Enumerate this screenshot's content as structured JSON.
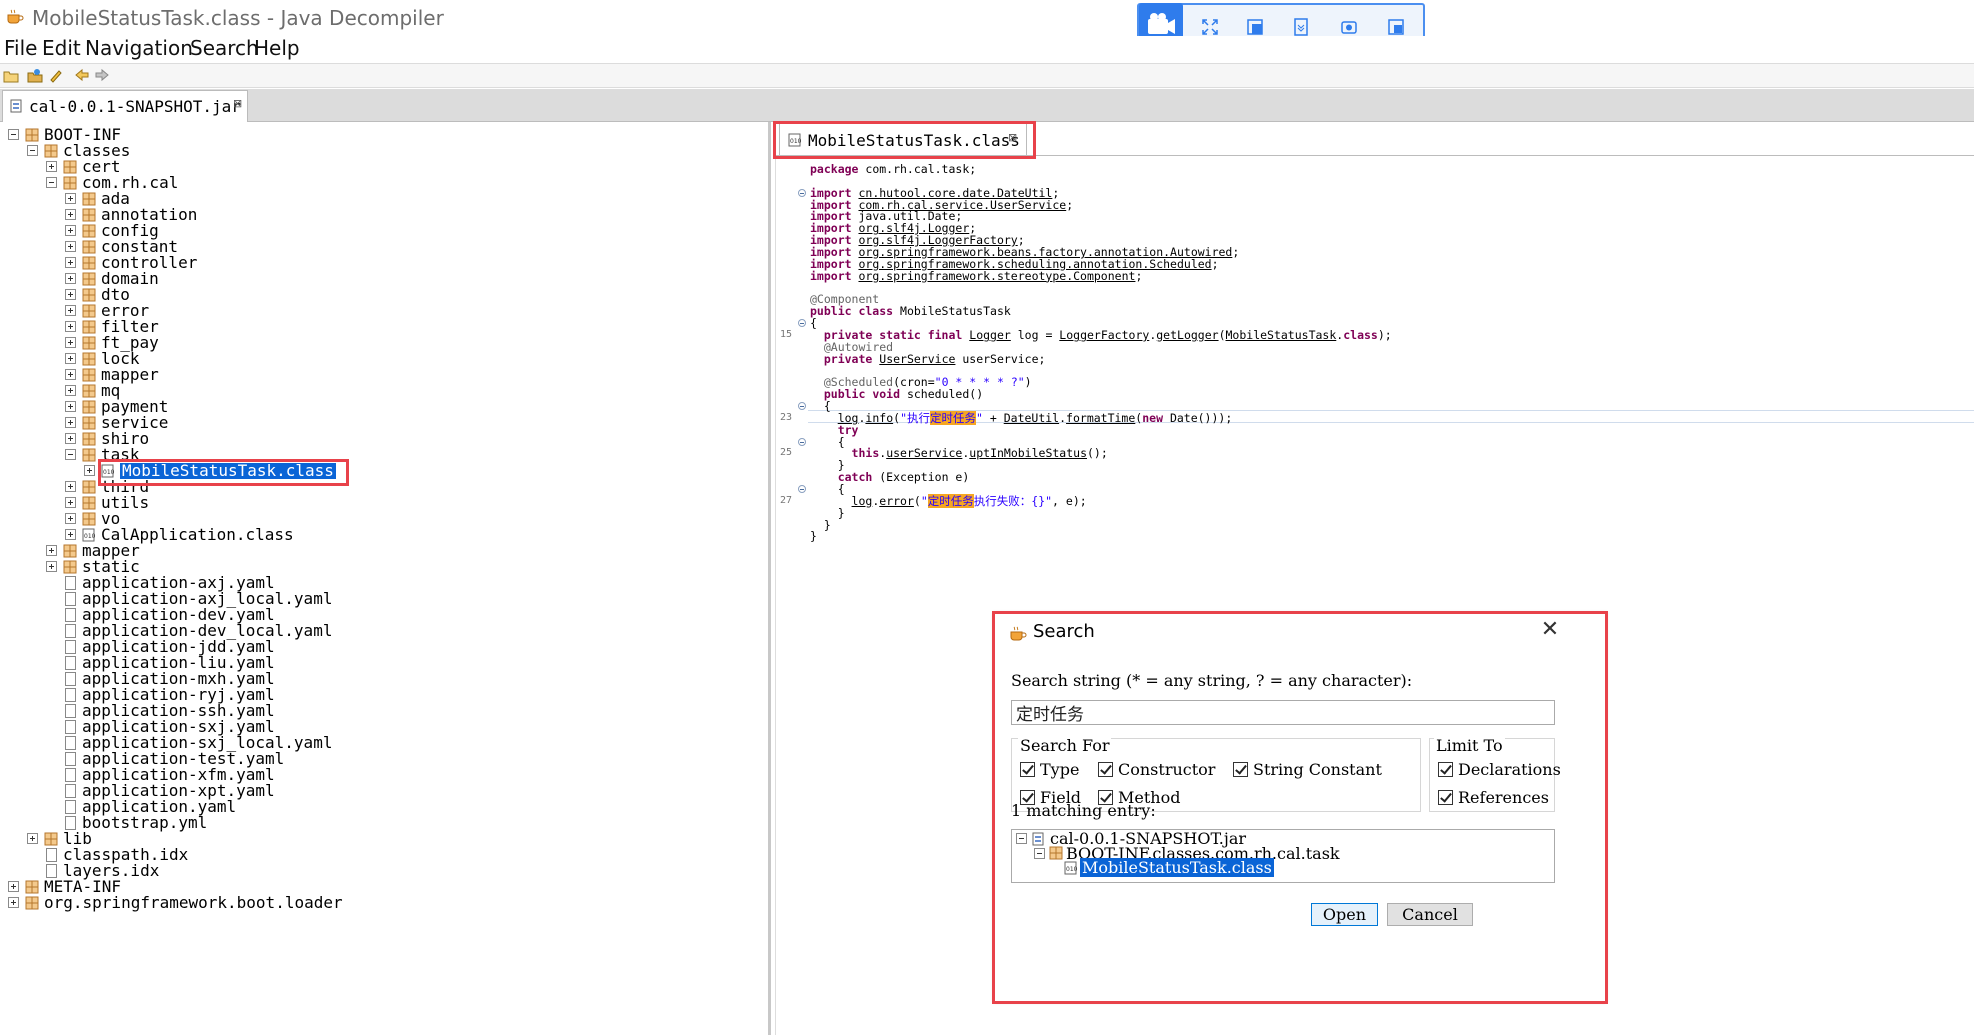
{
  "window": {
    "title": "MobileStatusTask.class - Java Decompiler"
  },
  "menu": [
    "File",
    "Edit",
    "Navigation",
    "Search",
    "Help"
  ],
  "toolbar_icons": [
    "open-file-icon",
    "open-type-icon",
    "search-icon",
    "back-icon",
    "forward-icon"
  ],
  "float_toolbar_icons": [
    "camera-icon",
    "fullscreen-icon",
    "region-icon",
    "scroll-capture-icon",
    "screenshot-icon",
    "window-capture-icon"
  ],
  "jar_tab": {
    "label": "cal-0.0.1-SNAPSHOT.jar"
  },
  "tree": [
    {
      "label": "BOOT-INF",
      "depth": 0,
      "type": "package",
      "expander": "minus"
    },
    {
      "label": "classes",
      "depth": 1,
      "type": "package",
      "expander": "minus"
    },
    {
      "label": "cert",
      "depth": 2,
      "type": "package",
      "expander": "plus"
    },
    {
      "label": "com.rh.cal",
      "depth": 2,
      "type": "package",
      "expander": "minus"
    },
    {
      "label": "ada",
      "depth": 3,
      "type": "package",
      "expander": "plus"
    },
    {
      "label": "annotation",
      "depth": 3,
      "type": "package",
      "expander": "plus"
    },
    {
      "label": "config",
      "depth": 3,
      "type": "package",
      "expander": "plus"
    },
    {
      "label": "constant",
      "depth": 3,
      "type": "package",
      "expander": "plus"
    },
    {
      "label": "controller",
      "depth": 3,
      "type": "package",
      "expander": "plus"
    },
    {
      "label": "domain",
      "depth": 3,
      "type": "package",
      "expander": "plus"
    },
    {
      "label": "dto",
      "depth": 3,
      "type": "package",
      "expander": "plus"
    },
    {
      "label": "error",
      "depth": 3,
      "type": "package",
      "expander": "plus"
    },
    {
      "label": "filter",
      "depth": 3,
      "type": "package",
      "expander": "plus"
    },
    {
      "label": "ft_pay",
      "depth": 3,
      "type": "package",
      "expander": "plus"
    },
    {
      "label": "lock",
      "depth": 3,
      "type": "package",
      "expander": "plus"
    },
    {
      "label": "mapper",
      "depth": 3,
      "type": "package",
      "expander": "plus"
    },
    {
      "label": "mq",
      "depth": 3,
      "type": "package",
      "expander": "plus"
    },
    {
      "label": "payment",
      "depth": 3,
      "type": "package",
      "expander": "plus"
    },
    {
      "label": "service",
      "depth": 3,
      "type": "package",
      "expander": "plus"
    },
    {
      "label": "shiro",
      "depth": 3,
      "type": "package",
      "expander": "plus"
    },
    {
      "label": "task",
      "depth": 3,
      "type": "package",
      "expander": "minus"
    },
    {
      "label": "MobileStatusTask.class",
      "depth": 4,
      "type": "class",
      "expander": "plus",
      "selected": true
    },
    {
      "label": "third",
      "depth": 3,
      "type": "package",
      "expander": "plus"
    },
    {
      "label": "utils",
      "depth": 3,
      "type": "package",
      "expander": "plus"
    },
    {
      "label": "vo",
      "depth": 3,
      "type": "package",
      "expander": "plus"
    },
    {
      "label": "CalApplication.class",
      "depth": 3,
      "type": "class",
      "expander": "plus"
    },
    {
      "label": "mapper",
      "depth": 2,
      "type": "package",
      "expander": "plus"
    },
    {
      "label": "static",
      "depth": 2,
      "type": "package",
      "expander": "plus"
    },
    {
      "label": "application-axj.yaml",
      "depth": 2,
      "type": "file"
    },
    {
      "label": "application-axj_local.yaml",
      "depth": 2,
      "type": "file"
    },
    {
      "label": "application-dev.yaml",
      "depth": 2,
      "type": "file"
    },
    {
      "label": "application-dev_local.yaml",
      "depth": 2,
      "type": "file"
    },
    {
      "label": "application-jdd.yaml",
      "depth": 2,
      "type": "file"
    },
    {
      "label": "application-liu.yaml",
      "depth": 2,
      "type": "file"
    },
    {
      "label": "application-mxh.yaml",
      "depth": 2,
      "type": "file"
    },
    {
      "label": "application-ryj.yaml",
      "depth": 2,
      "type": "file"
    },
    {
      "label": "application-ssh.yaml",
      "depth": 2,
      "type": "file"
    },
    {
      "label": "application-sxj.yaml",
      "depth": 2,
      "type": "file"
    },
    {
      "label": "application-sxj_local.yaml",
      "depth": 2,
      "type": "file"
    },
    {
      "label": "application-test.yaml",
      "depth": 2,
      "type": "file"
    },
    {
      "label": "application-xfm.yaml",
      "depth": 2,
      "type": "file"
    },
    {
      "label": "application-xpt.yaml",
      "depth": 2,
      "type": "file"
    },
    {
      "label": "application.yaml",
      "depth": 2,
      "type": "file"
    },
    {
      "label": "bootstrap.yml",
      "depth": 2,
      "type": "file"
    },
    {
      "label": "lib",
      "depth": 1,
      "type": "package",
      "expander": "plus"
    },
    {
      "label": "classpath.idx",
      "depth": 1,
      "type": "file"
    },
    {
      "label": "layers.idx",
      "depth": 1,
      "type": "file"
    },
    {
      "label": "META-INF",
      "depth": 0,
      "type": "package",
      "expander": "plus"
    },
    {
      "label": "org.springframework.boot.loader",
      "depth": 0,
      "type": "package",
      "expander": "plus"
    }
  ],
  "code_tab": {
    "label": "MobileStatusTask.class"
  },
  "code_lines": [
    {
      "ln": "",
      "fold": false,
      "html": "<span class=\"kw\">package</span> com.rh.cal.task;"
    },
    {
      "ln": "",
      "fold": false,
      "html": ""
    },
    {
      "ln": "",
      "fold": true,
      "html": "<span class=\"kw\">import</span> <span class=\"u\">cn.hutool.core.date.DateUtil</span>;"
    },
    {
      "ln": "",
      "fold": false,
      "html": "<span class=\"kw\">import</span> <span class=\"u\">com.rh.cal.service.UserService</span>;"
    },
    {
      "ln": "",
      "fold": false,
      "html": "<span class=\"kw\">import</span> java.util.Date;"
    },
    {
      "ln": "",
      "fold": false,
      "html": "<span class=\"kw\">import</span> <span class=\"u\">org.slf4j.Logger</span>;"
    },
    {
      "ln": "",
      "fold": false,
      "html": "<span class=\"kw\">import</span> <span class=\"u\">org.slf4j.LoggerFactory</span>;"
    },
    {
      "ln": "",
      "fold": false,
      "html": "<span class=\"kw\">import</span> <span class=\"u\">org.springframework.beans.factory.annotation.Autowired</span>;"
    },
    {
      "ln": "",
      "fold": false,
      "html": "<span class=\"kw\">import</span> <span class=\"u\">org.springframework.scheduling.annotation.Scheduled</span>;"
    },
    {
      "ln": "",
      "fold": false,
      "html": "<span class=\"kw\">import</span> <span class=\"u\">org.springframework.stereotype.Component</span>;"
    },
    {
      "ln": "",
      "fold": false,
      "html": ""
    },
    {
      "ln": "",
      "fold": false,
      "html": "<span class=\"ann\">@Component</span>"
    },
    {
      "ln": "",
      "fold": false,
      "html": "<span class=\"kw\">public class</span> MobileStatusTask"
    },
    {
      "ln": "",
      "fold": true,
      "html": "{"
    },
    {
      "ln": "15",
      "fold": false,
      "html": "  <span class=\"kw\">private static final</span> <span class=\"u\">Logger</span> log = <span class=\"u\">LoggerFactory</span>.<span class=\"u\">getLogger</span>(<span class=\"u\">MobileStatusTask</span>.<span class=\"kw\">class</span>);"
    },
    {
      "ln": "",
      "fold": false,
      "html": "  <span class=\"ann\">@Autowired</span>"
    },
    {
      "ln": "",
      "fold": false,
      "html": "  <span class=\"kw\">private</span> <span class=\"u\">UserService</span> userService;"
    },
    {
      "ln": "",
      "fold": false,
      "html": ""
    },
    {
      "ln": "",
      "fold": false,
      "html": "  <span class=\"ann\">@Scheduled</span>(cron=<span class=\"str\">\"0 * * * * ?\"</span>)"
    },
    {
      "ln": "",
      "fold": false,
      "html": "  <span class=\"kw\">public void</span> scheduled()"
    },
    {
      "ln": "",
      "fold": true,
      "html": "  {"
    },
    {
      "ln": "23",
      "fold": false,
      "html": "    <span class=\"u\">log</span>.<span class=\"u\">info</span>(<span class=\"str\">\"执行<span class=\"hl\">定时任务</span>\"</span> + <span class=\"u\">DateUtil</span>.<span class=\"u\">formatTime</span>(<span class=\"kw\">new</span> Date()));"
    },
    {
      "ln": "",
      "fold": false,
      "html": "    <span class=\"kw\">try</span>"
    },
    {
      "ln": "",
      "fold": true,
      "html": "    {"
    },
    {
      "ln": "25",
      "fold": false,
      "html": "      <span class=\"kw\">this</span>.<span class=\"u\">userService</span>.<span class=\"u\">uptInMobileStatus</span>();"
    },
    {
      "ln": "",
      "fold": false,
      "html": "    }"
    },
    {
      "ln": "",
      "fold": false,
      "html": "    <span class=\"kw\">catch</span> (Exception e)"
    },
    {
      "ln": "",
      "fold": true,
      "html": "    {"
    },
    {
      "ln": "27",
      "fold": false,
      "html": "      <span class=\"u\">log</span>.<span class=\"u\">error</span>(<span class=\"str\">\"<span class=\"hl\">定时任务</span>执行失败：{}\"</span>, e);"
    },
    {
      "ln": "",
      "fold": false,
      "html": "    }"
    },
    {
      "ln": "",
      "fold": false,
      "html": "  }"
    },
    {
      "ln": "",
      "fold": false,
      "html": "}"
    }
  ],
  "dialog": {
    "title": "Search",
    "close": "✕",
    "prompt": "Search string (* = any string, ? = any character):",
    "search_value": "定时任务",
    "search_for_label": "Search For",
    "limit_to_label": "Limit To",
    "opt_type": "Type",
    "opt_constructor": "Constructor",
    "opt_string_constant": "String Constant",
    "opt_field": "Field",
    "opt_method": "Method",
    "opt_declarations": "Declarations",
    "opt_references": "References",
    "matching": "1 matching entry:",
    "result_jar": "cal-0.0.1-SNAPSHOT.jar",
    "result_pkg": "BOOT-INF.classes.com.rh.cal.task",
    "result_class": "MobileStatusTask.class",
    "open_label": "Open",
    "cancel_label": "Cancel"
  }
}
